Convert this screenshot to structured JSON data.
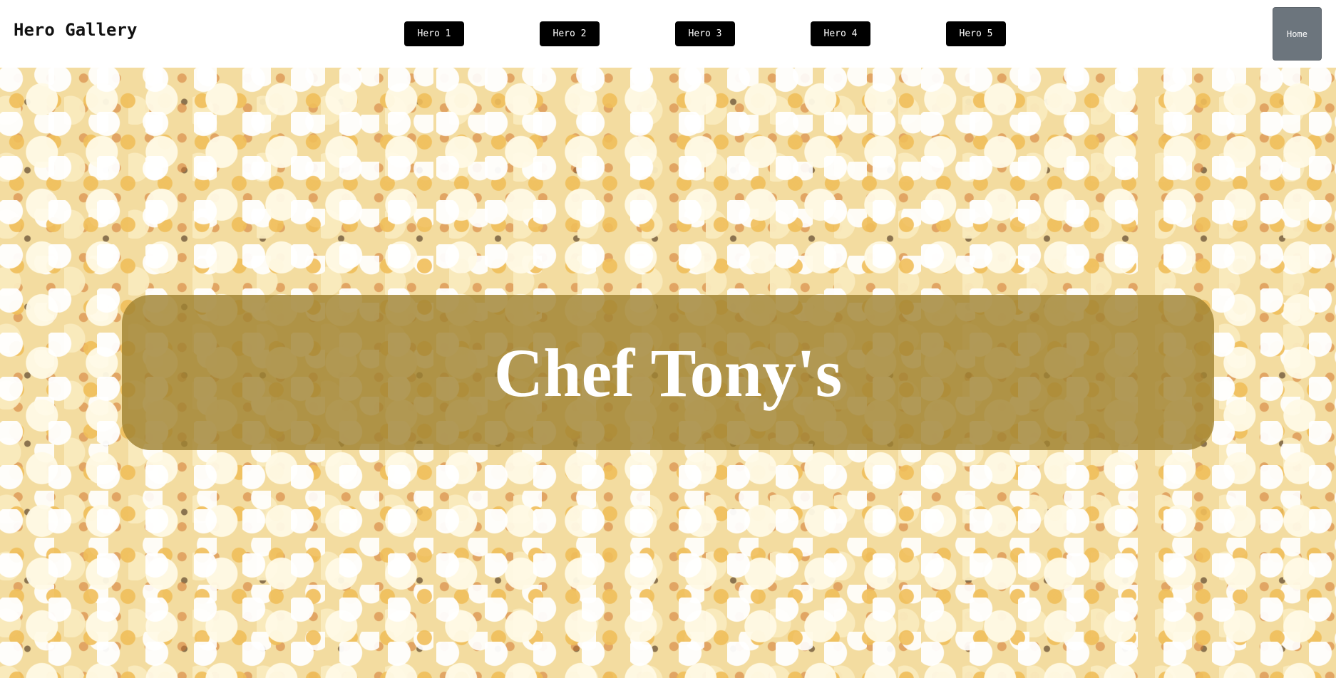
{
  "navbar": {
    "brand": "Hero Gallery",
    "buttons": [
      "Hero 1",
      "Hero 2",
      "Hero 3",
      "Hero 4",
      "Hero 5"
    ],
    "home_label": "Home"
  },
  "hero": {
    "title": "Chef Tony's",
    "background_image": "popcorn"
  },
  "colors": {
    "nav_button_bg": "#000000",
    "nav_button_text": "#ffffff",
    "home_button_bg": "#6c757d",
    "banner_bg": "#a0823a",
    "title_text": "#ffffff"
  }
}
